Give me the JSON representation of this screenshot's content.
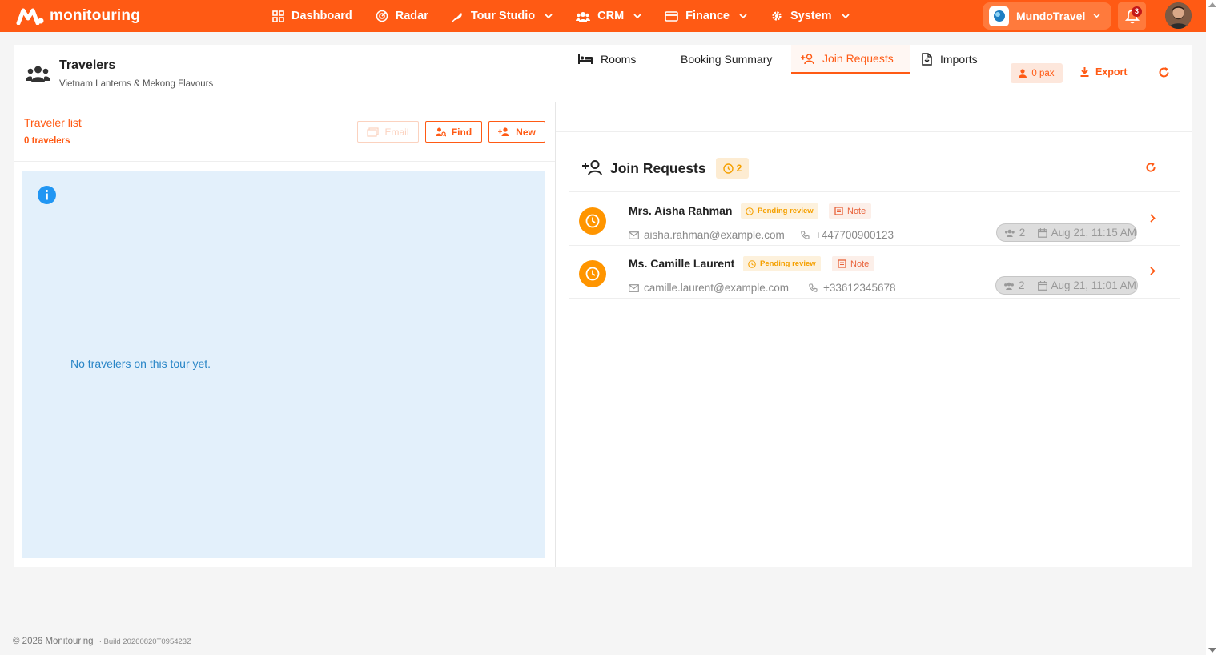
{
  "brand": {
    "name": "monitouring"
  },
  "nav": [
    {
      "label": "Dashboard",
      "icon": "grid-icon",
      "dropdown": false
    },
    {
      "label": "Radar",
      "icon": "radar-icon",
      "dropdown": false
    },
    {
      "label": "Tour Studio",
      "icon": "feather-icon",
      "dropdown": true
    },
    {
      "label": "CRM",
      "icon": "users-icon",
      "dropdown": true
    },
    {
      "label": "Finance",
      "icon": "card-icon",
      "dropdown": true
    },
    {
      "label": "System",
      "icon": "gear-icon",
      "dropdown": true
    }
  ],
  "workspace": {
    "name": "MundoTravel"
  },
  "notifications": {
    "count": "3"
  },
  "page": {
    "title": "Travelers",
    "subtitle": "Vietnam Lanterns & Mekong Flavours",
    "pax_label": "0 pax",
    "export_label": "Export"
  },
  "traveler_list": {
    "title": "Traveler list",
    "count": "0 travelers",
    "email_label": "Email",
    "find_label": "Find",
    "new_label": "New",
    "empty_message": "No travelers on this tour yet."
  },
  "tabs": [
    {
      "label": "Rooms",
      "active": false
    },
    {
      "label": "Booking Summary",
      "active": false
    },
    {
      "label": "Join Requests",
      "active": true
    },
    {
      "label": "Imports",
      "active": false
    }
  ],
  "join_requests": {
    "title": "Join Requests",
    "count": "2",
    "items": [
      {
        "name": "Mrs. Aisha Rahman",
        "status": "Pending review",
        "note_label": "Note",
        "email": "aisha.rahman@example.com",
        "phone": "+447700900123",
        "pax": "2",
        "date": "Aug 21, 11:15 AM"
      },
      {
        "name": "Ms. Camille Laurent",
        "status": "Pending review",
        "note_label": "Note",
        "email": "camille.laurent@example.com",
        "phone": "+33612345678",
        "pax": "2",
        "date": "Aug 21, 11:01 AM"
      }
    ]
  },
  "footer": {
    "copyright": "© 2026 Monitouring",
    "build": "· Build 20260820T095423Z"
  },
  "colors": {
    "accent": "#ff5a14",
    "pending": "#ff9500",
    "info": "#2a86c7"
  }
}
